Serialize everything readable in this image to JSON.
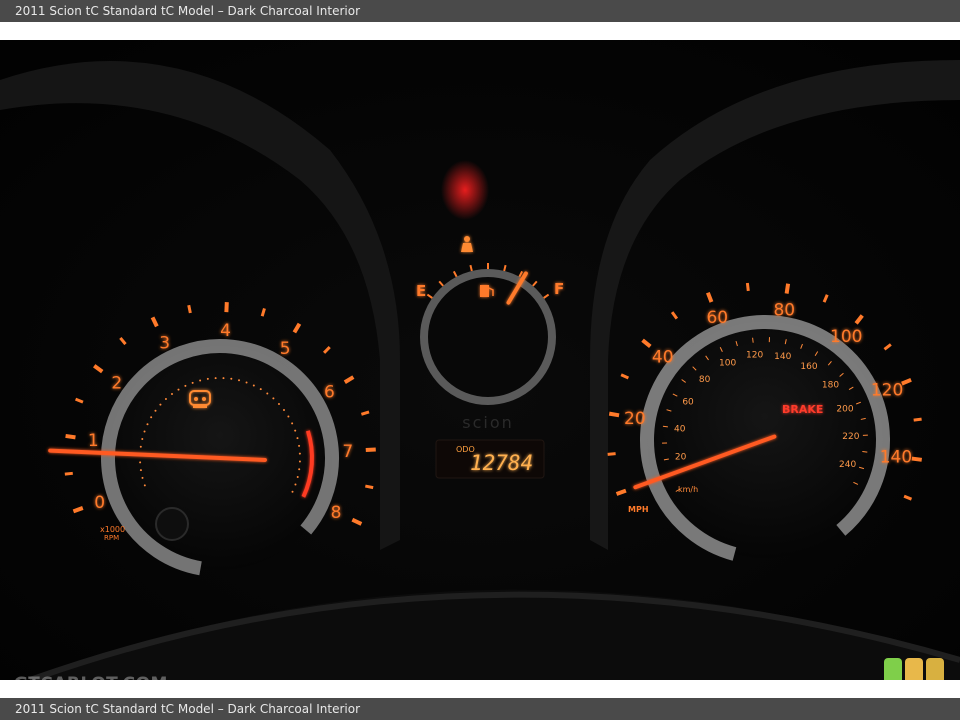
{
  "caption": {
    "top": "2011 Scion tC Standard tC Model – Dark Charcoal Interior",
    "bottom": "2011 Scion tC Standard tC Model – Dark Charcoal Interior"
  },
  "watermark": "GTCARLOT.COM",
  "colors": {
    "glow": "#ff7a2a",
    "glow_bright": "#ffb060",
    "needle": "#ff5a20",
    "warning_red": "#ff3030",
    "badge_green": "#7fcf4a",
    "badge_yellow": "#e8b84a",
    "badge_gold": "#d8b040"
  },
  "badge_icons": [
    "green-badge-icon",
    "yellow-badge-icon",
    "gold-badge-icon"
  ],
  "cluster": {
    "tachometer": {
      "numbers": [
        "0",
        "1",
        "2",
        "3",
        "4",
        "5",
        "6",
        "7",
        "8"
      ],
      "unit_top": "x1000",
      "unit_bottom": "RPM",
      "reading_krpm": 0.8
    },
    "fuel": {
      "empty": "E",
      "full": "F",
      "level": 0.78
    },
    "brand": "scion",
    "odometer": {
      "label": "ODO",
      "value": "12784"
    },
    "speedometer": {
      "mph_numbers": [
        "20",
        "40",
        "60",
        "80",
        "100",
        "120",
        "140"
      ],
      "kmh_numbers": [
        "20",
        "40",
        "60",
        "80",
        "100",
        "120",
        "140",
        "160",
        "180",
        "200",
        "220",
        "240"
      ],
      "mph_unit": "MPH",
      "kmh_unit": "km/h",
      "warning": "BRAKE",
      "reading_mph": 0
    }
  }
}
